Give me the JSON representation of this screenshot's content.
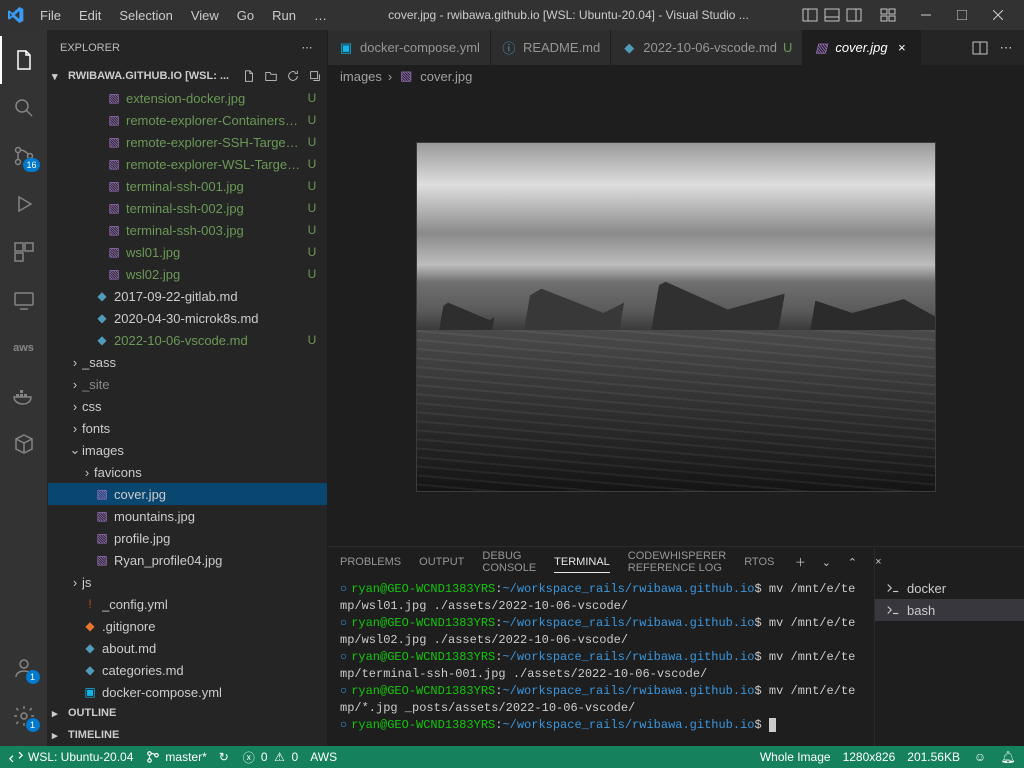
{
  "title": "cover.jpg - rwibawa.github.io [WSL: Ubuntu-20.04] - Visual Studio ...",
  "menu": [
    "File",
    "Edit",
    "Selection",
    "View",
    "Go",
    "Run",
    "…"
  ],
  "activity_badges": {
    "scm": "16",
    "accounts": "1",
    "settings": "1"
  },
  "sidebar": {
    "title": "EXPLORER",
    "workspace": "RWIBAWA.GITHUB.IO [WSL: ...",
    "outline": "OUTLINE",
    "timeline": "TIMELINE"
  },
  "tree": [
    {
      "label": "extension-docker.jpg",
      "depth": 3,
      "type": "img",
      "status": "U"
    },
    {
      "label": "remote-explorer-Containers.jpg",
      "depth": 3,
      "type": "img",
      "status": "U"
    },
    {
      "label": "remote-explorer-SSH-Targets.jpg",
      "depth": 3,
      "type": "img",
      "status": "U"
    },
    {
      "label": "remote-explorer-WSL-Targets.jpg",
      "depth": 3,
      "type": "img",
      "status": "U"
    },
    {
      "label": "terminal-ssh-001.jpg",
      "depth": 3,
      "type": "img",
      "status": "U"
    },
    {
      "label": "terminal-ssh-002.jpg",
      "depth": 3,
      "type": "img",
      "status": "U"
    },
    {
      "label": "terminal-ssh-003.jpg",
      "depth": 3,
      "type": "img",
      "status": "U"
    },
    {
      "label": "wsl01.jpg",
      "depth": 3,
      "type": "img",
      "status": "U"
    },
    {
      "label": "wsl02.jpg",
      "depth": 3,
      "type": "img",
      "status": "U"
    },
    {
      "label": "2017-09-22-gitlab.md",
      "depth": 2,
      "type": "md",
      "chev": ""
    },
    {
      "label": "2020-04-30-microk8s.md",
      "depth": 2,
      "type": "md",
      "chev": ""
    },
    {
      "label": "2022-10-06-vscode.md",
      "depth": 2,
      "type": "md",
      "status": "U"
    },
    {
      "label": "_sass",
      "depth": 1,
      "type": "fld",
      "chev": "right"
    },
    {
      "label": "_site",
      "depth": 1,
      "type": "fld",
      "chev": "right",
      "dim": true
    },
    {
      "label": "css",
      "depth": 1,
      "type": "fld",
      "chev": "right"
    },
    {
      "label": "fonts",
      "depth": 1,
      "type": "fld",
      "chev": "right"
    },
    {
      "label": "images",
      "depth": 1,
      "type": "fld",
      "chev": "down"
    },
    {
      "label": "favicons",
      "depth": 2,
      "type": "fld",
      "chev": "right"
    },
    {
      "label": "cover.jpg",
      "depth": 2,
      "type": "img",
      "selected": true
    },
    {
      "label": "mountains.jpg",
      "depth": 2,
      "type": "img"
    },
    {
      "label": "profile.jpg",
      "depth": 2,
      "type": "img"
    },
    {
      "label": "Ryan_profile04.jpg",
      "depth": 2,
      "type": "img"
    },
    {
      "label": "js",
      "depth": 1,
      "type": "fld",
      "chev": "right"
    },
    {
      "label": "_config.yml",
      "depth": 1,
      "type": "yml"
    },
    {
      "label": ".gitignore",
      "depth": 1,
      "type": "git"
    },
    {
      "label": "about.md",
      "depth": 1,
      "type": "md"
    },
    {
      "label": "categories.md",
      "depth": 1,
      "type": "md"
    },
    {
      "label": "docker-compose.yml",
      "depth": 1,
      "type": "dck"
    }
  ],
  "tabs": [
    {
      "icon": "dck",
      "label": "docker-compose.yml"
    },
    {
      "icon": "info",
      "label": "README.md"
    },
    {
      "icon": "md",
      "label": "2022-10-06-vscode.md",
      "dirty": "U",
      "dcolor": "#6a9955"
    },
    {
      "icon": "img",
      "label": "cover.jpg",
      "active": true,
      "close": true
    }
  ],
  "breadcrumb": [
    "images",
    "cover.jpg"
  ],
  "panel": {
    "tabs": [
      "PROBLEMS",
      "OUTPUT",
      "DEBUG CONSOLE",
      "TERMINAL",
      "CODEWHISPERER REFERENCE LOG",
      "RTOS"
    ],
    "active": "TERMINAL",
    "side": [
      {
        "icon": "term",
        "label": "docker"
      },
      {
        "icon": "term",
        "label": "bash",
        "active": true
      }
    ]
  },
  "terminal": [
    {
      "user": "ryan",
      "host": "GEO-WCND1383YRS",
      "path": "~/workspace_rails/rwibawa.github.io",
      "cmd": "mv /mnt/e/temp/wsl01.jpg ./assets/2022-10-06-vscode/"
    },
    {
      "user": "ryan",
      "host": "GEO-WCND1383YRS",
      "path": "~/workspace_rails/rwibawa.github.io",
      "cmd": "mv /mnt/e/temp/wsl02.jpg ./assets/2022-10-06-vscode/"
    },
    {
      "user": "ryan",
      "host": "GEO-WCND1383YRS",
      "path": "~/workspace_rails/rwibawa.github.io",
      "cmd": "mv /mnt/e/temp/terminal-ssh-001.jpg ./assets/2022-10-06-vscode/"
    },
    {
      "user": "ryan",
      "host": "GEO-WCND1383YRS",
      "path": "~/workspace_rails/rwibawa.github.io",
      "cmd": "mv /mnt/e/temp/*.jpg _posts/assets/2022-10-06-vscode/"
    },
    {
      "user": "ryan",
      "host": "GEO-WCND1383YRS",
      "path": "~/workspace_rails/rwibawa.github.io",
      "cmd": "",
      "cursor": true
    }
  ],
  "status": {
    "remote": "WSL: Ubuntu-20.04",
    "branch": "master*",
    "sync": "↻",
    "errors": "0",
    "warnings": "0",
    "aws": "AWS",
    "right": {
      "wholeImage": "Whole Image",
      "dims": "1280x826",
      "size": "201.56KB"
    }
  },
  "colors": {
    "md": "#519aba",
    "img": "#a074c4",
    "yml": "#cb4b16",
    "dck": "#0db7ed",
    "git": "#e8762c",
    "info": "#519aba"
  }
}
